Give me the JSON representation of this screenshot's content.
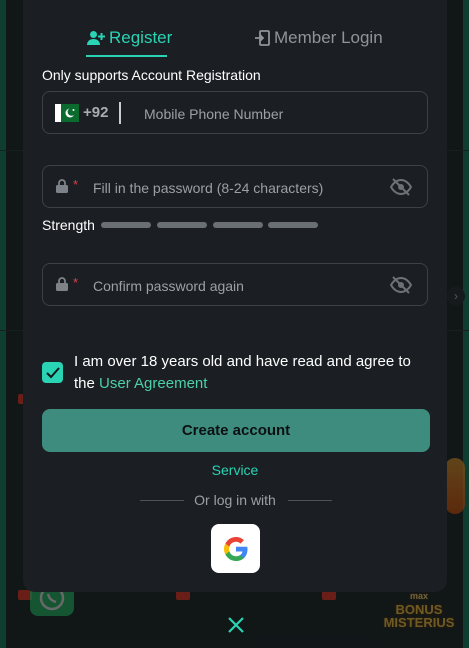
{
  "tabs": {
    "register_label": "Register",
    "login_label": "Member Login"
  },
  "form": {
    "hint": "Only supports Account Registration",
    "phone": {
      "country_code": "+92",
      "placeholder": "Mobile Phone Number",
      "value": ""
    },
    "password": {
      "required_mark": "*",
      "placeholder": "Fill in the password (8-24 characters)",
      "value": ""
    },
    "strength_label": "Strength",
    "confirm": {
      "required_mark": "*",
      "placeholder": "Confirm password again",
      "value": ""
    },
    "agreement": {
      "checked": true,
      "text": "I am over 18 years old and have read and agree to the ",
      "link": "User Agreement"
    },
    "create_label": "Create account",
    "service_label": "Service",
    "or_label": "Or log in with"
  },
  "background": {
    "bonus_small": "max",
    "bonus_text": "BONUS MISTERIUS"
  },
  "colors": {
    "accent": "#2ad3b3",
    "button": "#3e8c7e",
    "modal_bg": "#1b1f23",
    "required": "#e0404a"
  },
  "icons": {
    "register": "person-add-icon",
    "login": "login-door-icon",
    "flag": "pakistan-flag-icon",
    "lock": "lock-icon",
    "eye": "eye-off-icon",
    "check": "checkmark-icon",
    "google": "google-icon",
    "close": "close-icon"
  }
}
